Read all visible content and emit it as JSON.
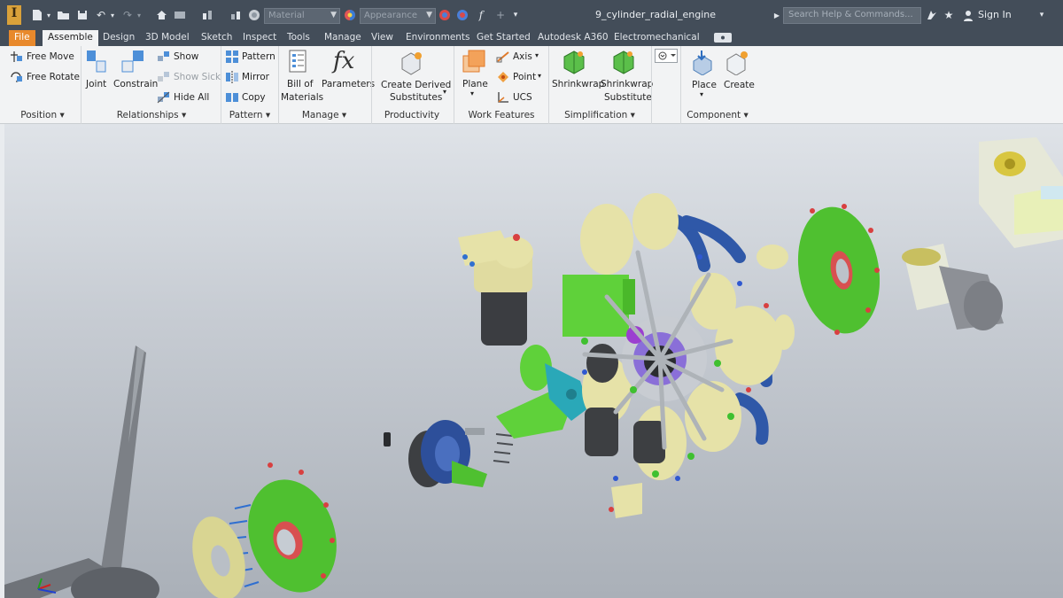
{
  "window": {
    "document_title": "9_cylinder_radial_engine",
    "search_placeholder": "Search Help & Commands...",
    "sign_in": "Sign In",
    "material_combo": "Material",
    "appearance_combo": "Appearance",
    "logo": "I"
  },
  "tabs": [
    {
      "label": "File"
    },
    {
      "label": "Assemble"
    },
    {
      "label": "Design"
    },
    {
      "label": "3D Model"
    },
    {
      "label": "Sketch"
    },
    {
      "label": "Inspect"
    },
    {
      "label": "Tools"
    },
    {
      "label": "Manage"
    },
    {
      "label": "View"
    },
    {
      "label": "Environments"
    },
    {
      "label": "Get Started"
    },
    {
      "label": "Autodesk A360"
    },
    {
      "label": "Electromechanical"
    }
  ],
  "ribbon": {
    "position": {
      "free_move": "Free Move",
      "free_rotate": "Free Rotate",
      "label": "Position"
    },
    "relationships": {
      "joint": "Joint",
      "constrain": "Constrain",
      "show": "Show",
      "show_sick": "Show Sick",
      "hide_all": "Hide All",
      "label": "Relationships"
    },
    "pattern": {
      "pattern": "Pattern",
      "mirror": "Mirror",
      "copy": "Copy",
      "label": "Pattern"
    },
    "manage": {
      "bom_line1": "Bill of",
      "bom_line2": "Materials",
      "parameters": "Parameters",
      "label": "Manage"
    },
    "productivity": {
      "line1": "Create Derived",
      "line2": "Substitutes",
      "label": "Productivity"
    },
    "work_features": {
      "plane": "Plane",
      "axis": "Axis",
      "point": "Point",
      "ucs": "UCS",
      "label": "Work Features"
    },
    "simplification": {
      "shrinkwrap": "Shrinkwrap",
      "substitute_line1": "Shrinkwrap",
      "substitute_line2": "Substitute",
      "label": "Simplification"
    },
    "component": {
      "place": "Place",
      "create": "Create",
      "label": "Component"
    }
  },
  "colors": {
    "title_bar": "#434d59",
    "file_tab": "#e8892c",
    "ribbon": "#f2f3f4",
    "engine_yellow": "#e6e2a8",
    "engine_green": "#5fd13a",
    "engine_blue": "#2f58a8",
    "engine_dark": "#3d3f42"
  }
}
